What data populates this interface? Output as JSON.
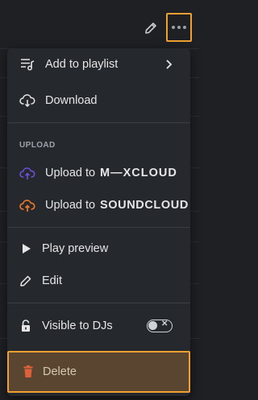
{
  "menu": {
    "add_to_playlist": "Add to playlist",
    "download": "Download",
    "upload_section": "UPLOAD",
    "upload_to": "Upload to",
    "mixcloud": "M—XCLOUD",
    "soundcloud": "SOUNDCLOUD",
    "play_preview": "Play preview",
    "edit": "Edit",
    "visible_to_djs": "Visible to DJs",
    "delete": "Delete"
  },
  "colors": {
    "highlight": "#f0a030",
    "mixcloud": "#6b4fd8",
    "soundcloud": "#f07a2a",
    "delete_icon": "#e0603a"
  },
  "icons": [
    "edit-icon",
    "more-icon",
    "playlist-add-icon",
    "chevron-right-icon",
    "cloud-download-icon",
    "cloud-upload-icon",
    "play-icon",
    "pencil-icon",
    "lock-icon",
    "trash-icon"
  ]
}
